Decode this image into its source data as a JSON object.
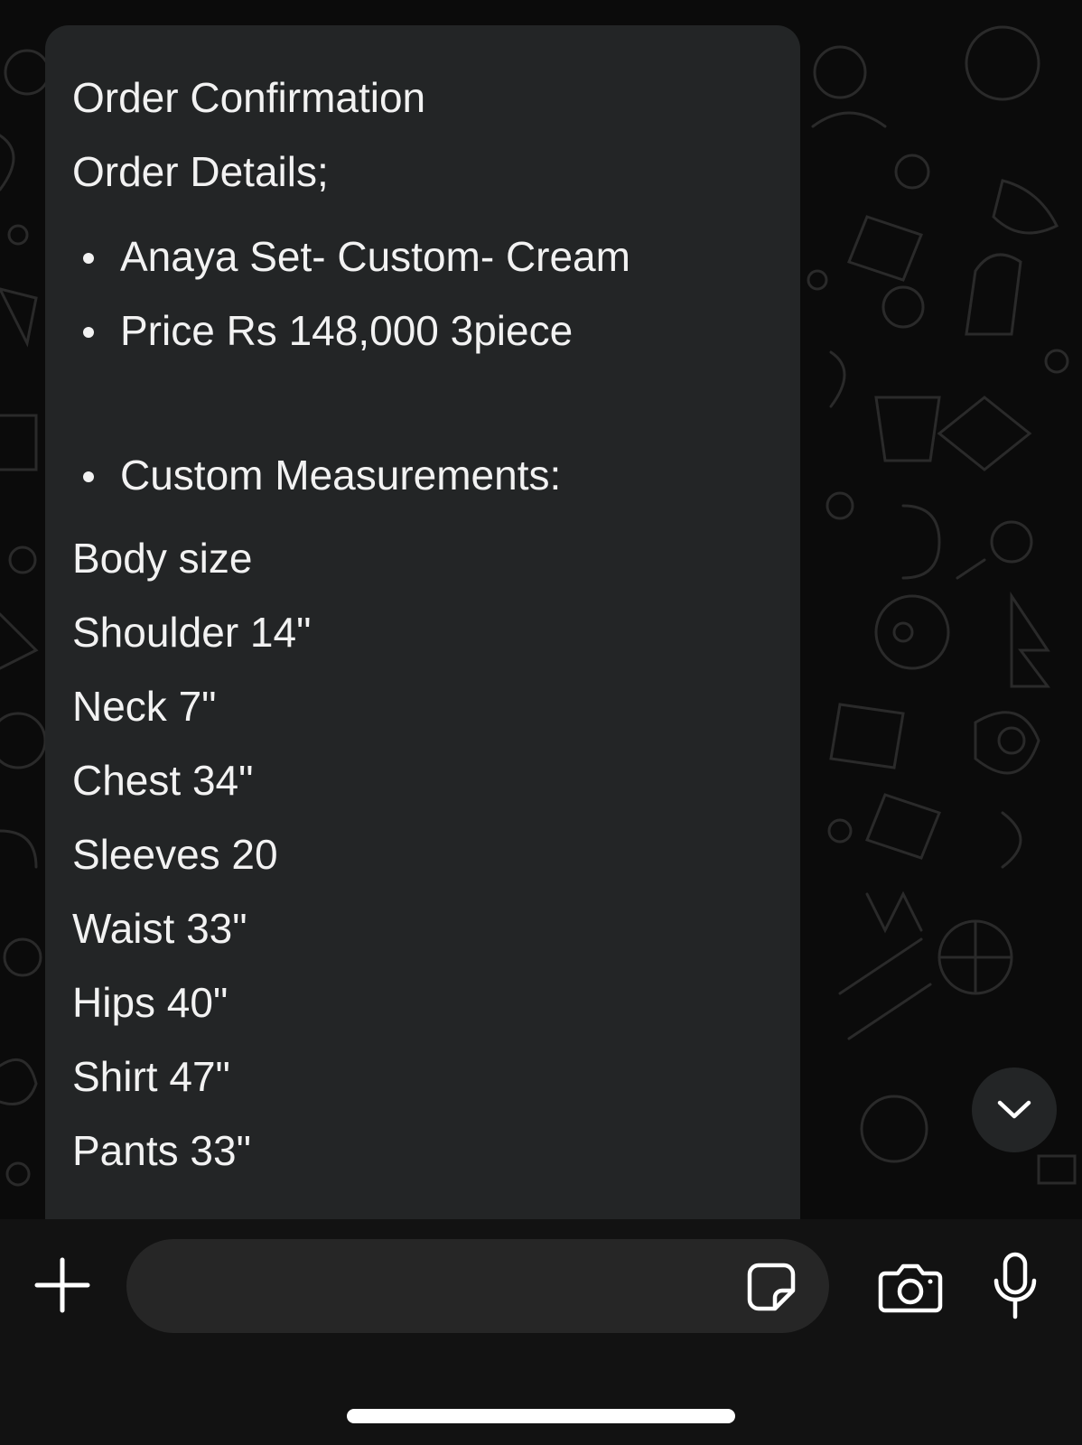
{
  "message": {
    "title": "Order Confirmation",
    "subtitle": "Order Details;",
    "bullets": [
      "Anaya Set- Custom- Cream",
      "Price Rs 148,000 3piece",
      "Custom Measurements:"
    ],
    "measurements": [
      "Body size",
      "Shoulder 14\"",
      "Neck 7\"",
      "Chest 34\"",
      "Sleeves 20",
      "Waist 33\"",
      "Hips 40\"",
      "Shirt 47\"",
      "Pants 33\""
    ]
  },
  "composer": {
    "input_value": "",
    "icons": {
      "attach": "plus-icon",
      "sticker": "sticker-icon",
      "camera": "camera-icon",
      "mic": "microphone-icon"
    }
  },
  "scroll_button": {
    "icon": "chevron-down-icon"
  },
  "colors": {
    "background": "#0b0b0b",
    "bubble": "#232526",
    "text": "#f2f2f2",
    "input": "#262626"
  }
}
